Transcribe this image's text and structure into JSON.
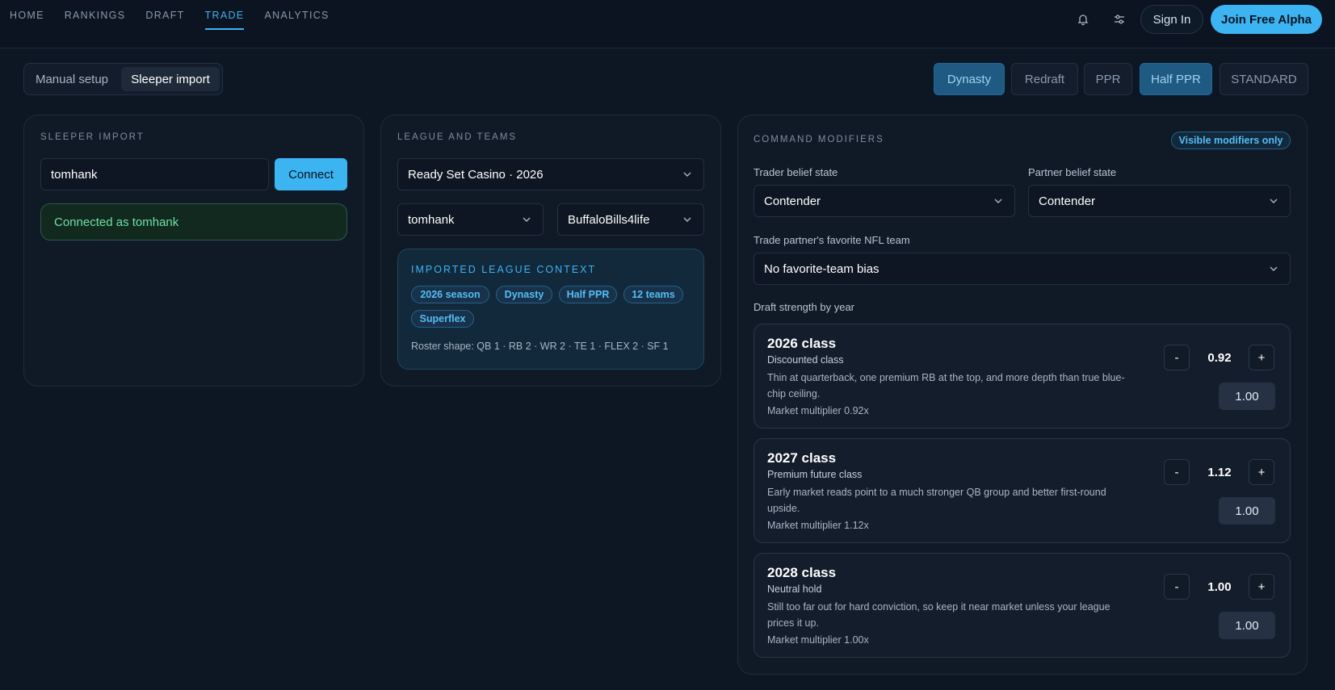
{
  "nav": {
    "items": [
      "HOME",
      "RANKINGS",
      "DRAFT",
      "TRADE",
      "ANALYTICS"
    ],
    "active": "TRADE",
    "sign_in": "Sign In",
    "join": "Join Free Alpha",
    "icons": [
      "bell-icon",
      "sliders-icon"
    ]
  },
  "mode": {
    "manual": "Manual setup",
    "sleeper": "Sleeper import",
    "selected": "Sleeper import"
  },
  "filters": {
    "dynasty": "Dynasty",
    "redraft": "Redraft",
    "ppr": "PPR",
    "half_ppr": "Half PPR",
    "standard": "STANDARD",
    "active": [
      "Dynasty",
      "Half PPR"
    ]
  },
  "sleeper": {
    "label": "SLEEPER IMPORT",
    "username": "tomhank",
    "connect": "Connect",
    "status": "Connected as tomhank"
  },
  "league": {
    "label": "LEAGUE AND TEAMS",
    "selected_league": "Ready Set Casino · 2026",
    "my_team": "tomhank",
    "partner_team": "BuffaloBills4life",
    "context_title": "IMPORTED LEAGUE CONTEXT",
    "tags": [
      "2026 season",
      "Dynasty",
      "Half PPR",
      "12 teams",
      "Superflex"
    ],
    "roster_shape": "Roster shape: QB 1 · RB 2 · WR 2 · TE 1 · FLEX 2 · SF 1"
  },
  "modifiers": {
    "label": "COMMAND MODIFIERS",
    "badge": "Visible modifiers only",
    "trader_label": "Trader belief state",
    "trader_value": "Contender",
    "partner_label": "Partner belief state",
    "partner_value": "Contender",
    "fav_label": "Trade partner's favorite NFL team",
    "fav_value": "No favorite-team bias",
    "draft_label": "Draft strength by year",
    "classes": [
      {
        "title": "2026 class",
        "subtitle": "Discounted class",
        "desc": "Thin at quarterback, one premium RB at the top, and more depth than true blue-chip ceiling.",
        "multiplier": "Market multiplier 0.92x",
        "value": "0.92",
        "input": "1.00"
      },
      {
        "title": "2027 class",
        "subtitle": "Premium future class",
        "desc": "Early market reads point to a much stronger QB group and better first-round upside.",
        "multiplier": "Market multiplier 1.12x",
        "value": "1.12",
        "input": "1.00"
      },
      {
        "title": "2028 class",
        "subtitle": "Neutral hold",
        "desc": "Still too far out for hard conviction, so keep it near market unless your league prices it up.",
        "multiplier": "Market multiplier 1.00x",
        "value": "1.00",
        "input": "1.00"
      }
    ],
    "minus": "-",
    "plus": "+"
  },
  "colors": {
    "background": "#0d1623",
    "accent": "#3db4f2",
    "success": "#6fe0a5",
    "active_pill": "#1e5a82"
  }
}
